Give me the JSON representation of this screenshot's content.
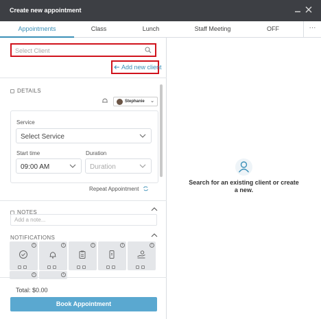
{
  "window": {
    "title": "Create new appointment",
    "minimize_icon": "minimize-icon",
    "close_icon": "close-icon"
  },
  "tabs": [
    {
      "label": "Appointments",
      "active": true
    },
    {
      "label": "Class",
      "active": false
    },
    {
      "label": "Lunch",
      "active": false
    },
    {
      "label": "Staff Meeting",
      "active": false
    },
    {
      "label": "OFF",
      "active": false
    }
  ],
  "tabs_more_label": "···",
  "client": {
    "search_placeholder": "Select Client",
    "add_new_label": "Add new client"
  },
  "details": {
    "heading": "DETAILS",
    "staff_name": "Stephanie",
    "service_label": "Service",
    "service_value": "Select Service",
    "start_time_label": "Start time",
    "start_time_value": "09:00 AM",
    "duration_label": "Duration",
    "duration_value": "Duration",
    "repeat_label": "Repeat Appointment"
  },
  "notes": {
    "heading": "NOTES",
    "placeholder": "Add a note..."
  },
  "notifications": {
    "heading": "NOTIFICATIONS",
    "tiles": [
      "check-circle-icon",
      "bell-icon",
      "clipboard-icon",
      "phone-icon",
      "hand-money-icon",
      "tile-icon",
      "tile-icon"
    ]
  },
  "footer": {
    "total": "Total: $0.00",
    "book_label": "Book Appointment"
  },
  "empty_state": {
    "icon": "user-icon",
    "text": "Search for an existing client or create a new."
  },
  "colors": {
    "accent": "#3a8fb7",
    "button": "#5aa8d0",
    "highlight": "#d0121c",
    "titlebar": "#3d3f44"
  }
}
